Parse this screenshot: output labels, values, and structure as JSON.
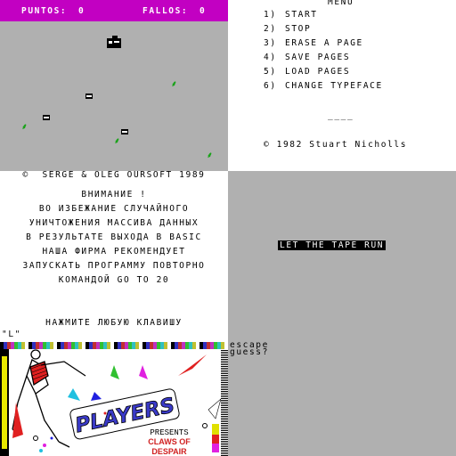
{
  "game": {
    "score_label": "PUNTOS:",
    "score_value": "0",
    "fails_label": "FALLOS:",
    "fails_value": "0",
    "colors": {
      "bar": "#c200c2",
      "field": "#b0b0b0",
      "leaf": "#1aa31a"
    }
  },
  "menu": {
    "title": "MENU",
    "items": [
      {
        "num": "1)",
        "label": "START"
      },
      {
        "num": "2)",
        "label": "STOP"
      },
      {
        "num": "3)",
        "label": "ERASE A PAGE"
      },
      {
        "num": "4)",
        "label": "SAVE PAGES"
      },
      {
        "num": "5)",
        "label": "LOAD PAGES"
      },
      {
        "num": "6)",
        "label": "CHANGE TYPEFACE"
      }
    ],
    "divider": "____",
    "copyright": "© 1982 Stuart Nicholls"
  },
  "russian": {
    "copyright": "©  SERGE & OLEG OURSOFT 1989",
    "heading": "ВНИМАНИЕ !",
    "lines": [
      "ВО ИЗБЕЖАНИЕ СЛУЧАЙНОГО",
      "УНИЧТОЖЕНИЯ МАССИВА ДАННЫХ",
      "В РЕЗУЛЬТАТЕ ВЫХОДА В BASIC",
      "НАША ФИРМА РЕКОМЕНДУЕТ",
      "ЗАПУСКАТЬ ПРОГРАММУ ПОВТОРНО",
      "КОМАНДОЙ GO TO 20"
    ],
    "prompt": "НАЖМИТЕ ЛЮБУЮ КЛАВИШУ"
  },
  "tape": {
    "message": "LET THE TAPE RUN"
  },
  "adventure": {
    "line1": "escape",
    "line2": "guess?"
  },
  "loading": {
    "label": "\"L\"",
    "logo": "PLAYERS",
    "presents": "PRESENTS",
    "title_line1": "CLAWS OF",
    "title_line2": "DESPAIR"
  }
}
